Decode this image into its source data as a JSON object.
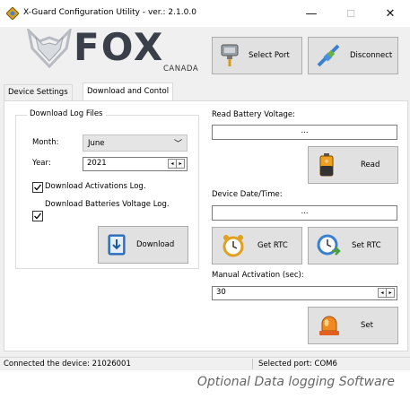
{
  "window": {
    "title": "X-Guard Configuration Utility - ver.: 2.1.0.0",
    "minimize_glyph": "—",
    "maximize_glyph": "☐",
    "close_glyph": "✕"
  },
  "logo": {
    "brand": "FOX",
    "sub": "CANADA"
  },
  "toolbar": {
    "select_port_label": "Select Port",
    "disconnect_label": "Disconnect"
  },
  "tabs": [
    {
      "label": "Device Settings",
      "active": false
    },
    {
      "label": "Download and Contol",
      "active": true
    }
  ],
  "download_group": {
    "title": "Download Log Files",
    "month_label": "Month:",
    "month_value": "June",
    "year_label": "Year:",
    "year_value": "2021",
    "activations_label": "Download Activations Log.",
    "activations_checked": true,
    "battery_label": "Download Batteries Voltage Log.",
    "battery_checked": true,
    "download_button_label": "Download"
  },
  "battery": {
    "label": "Read Battery Voltage:",
    "value": "...",
    "read_button_label": "Read"
  },
  "datetime": {
    "label": "Device Date/Time:",
    "value": "...",
    "get_rtc_label": "Get RTC",
    "set_rtc_label": "Set RTC"
  },
  "manual": {
    "label": "Manual Activation (sec):",
    "value": "30",
    "set_button_label": "Set"
  },
  "status_bar": {
    "connected": "Connected the device: 21026001",
    "port": "Selected port: COM6"
  },
  "caption": "Optional Data logging Software",
  "colors": {
    "window_bg": "#f0f0f0",
    "button_bg": "#e1e1e1",
    "logo_dark": "#3a3f4a",
    "accent_orange": "#e8a020"
  }
}
